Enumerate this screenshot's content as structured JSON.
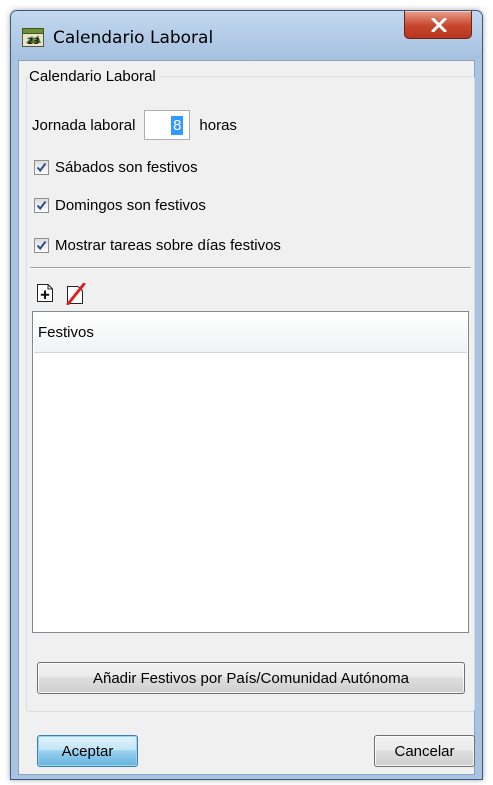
{
  "window": {
    "title": "Calendario Laboral",
    "icon": "calendar-app-icon",
    "close_icon": "close-icon"
  },
  "group": {
    "legend": "Calendario Laboral"
  },
  "workday": {
    "label": "Jornada laboral",
    "value": "8",
    "unit": "horas"
  },
  "options": {
    "saturdays": {
      "label": "Sábados son festivos",
      "checked": true
    },
    "sundays": {
      "label": "Domingos son festivos",
      "checked": true
    },
    "show_tasks": {
      "label": "Mostrar tareas sobre días festivos",
      "checked": true
    }
  },
  "toolbar": {
    "add_icon": "add-holiday-icon",
    "delete_icon": "delete-holiday-icon"
  },
  "holidays_table": {
    "column_header": "Festivos",
    "rows": []
  },
  "buttons": {
    "add_by_region": "Añadir Festivos por País/Comunidad Autónoma",
    "accept": "Aceptar",
    "cancel": "Cancelar"
  },
  "colors": {
    "title_bar": "#a9c4e2",
    "close_button": "#c7452c",
    "selection": "#3399ff",
    "check": "#2a4f8a",
    "delete_slash": "#e02020"
  }
}
